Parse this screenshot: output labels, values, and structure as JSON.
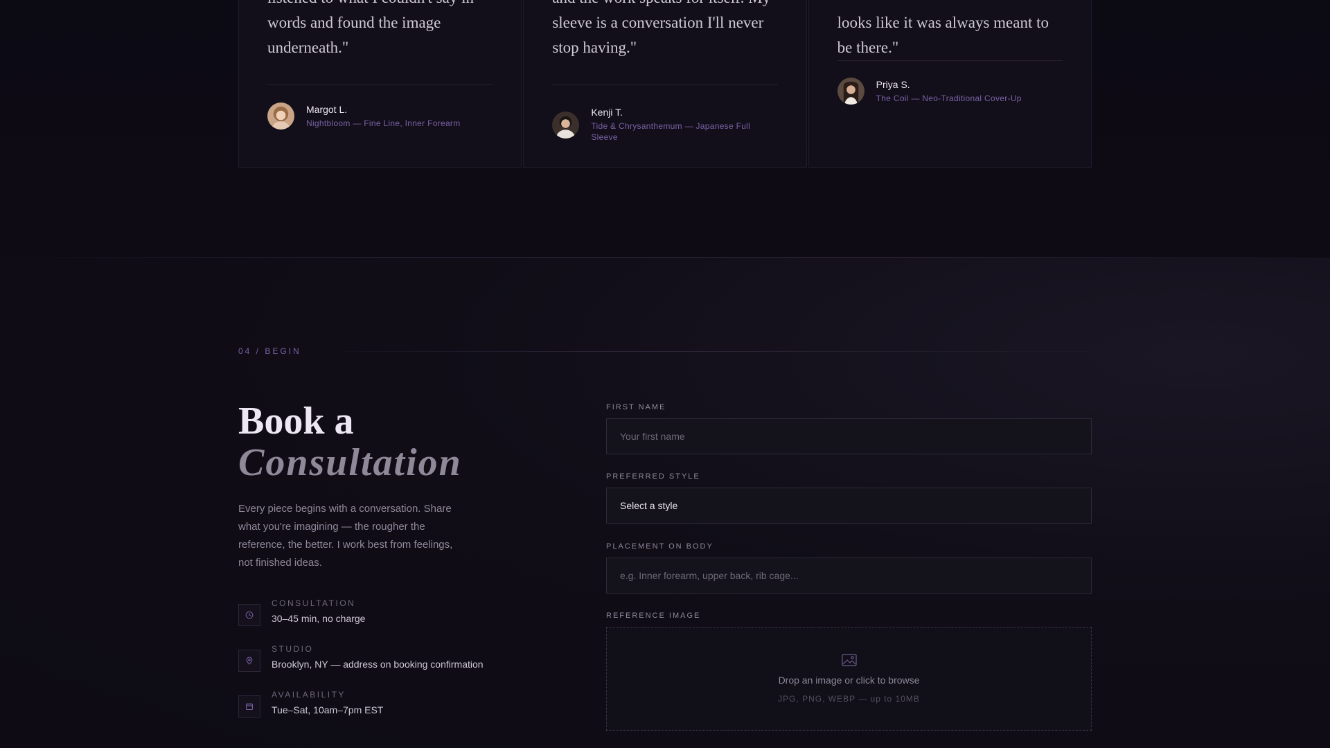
{
  "testimonials": [
    {
      "quote": "listened to what I couldn't say in words and found the image underneath.\"",
      "name": "Margot L.",
      "piece": "Nightbloom — Fine Line, Inner Forearm"
    },
    {
      "quote": "and the work speaks for itself. My sleeve is a conversation I'll never stop having.\"",
      "name": "Kenji T.",
      "piece": "Tide & Chrysanthemum — Japanese Full Sleeve"
    },
    {
      "quote": "looks like it was always meant to be there.\"",
      "name": "Priya S.",
      "piece": "The Coil — Neo-Traditional Cover-Up"
    }
  ],
  "booking": {
    "eyebrow": "04 / BEGIN",
    "heading_line1": "Book a",
    "heading_line2": "Consultation",
    "intro": "Every piece begins with a conversation. Share what you're imagining — the rougher the reference, the better. I work best from feelings, not finished ideas.",
    "info": [
      {
        "icon": "clock-icon",
        "label": "CONSULTATION",
        "value": "30–45 min, no charge"
      },
      {
        "icon": "location-pin-icon",
        "label": "STUDIO",
        "value": "Brooklyn, NY — address on booking confirmation"
      },
      {
        "icon": "calendar-icon",
        "label": "AVAILABILITY",
        "value": "Tue–Sat, 10am–7pm EST"
      }
    ]
  },
  "form": {
    "first_name_label": "FIRST NAME",
    "first_name_placeholder": "Your first name",
    "first_name_value": "",
    "style_label": "PREFERRED STYLE",
    "style_selected": "Select a style",
    "placement_label": "PLACEMENT ON BODY",
    "placement_placeholder": "e.g. Inner forearm, upper back, rib cage...",
    "placement_value": "",
    "reference_label": "REFERENCE IMAGE",
    "drop_main": "Drop an image or click to browse",
    "drop_sub": "JPG, PNG, WEBP — up to 10MB"
  },
  "colors": {
    "accent": "#7a62a6",
    "background": "#0f0c16",
    "field_bg": "#14121a"
  }
}
